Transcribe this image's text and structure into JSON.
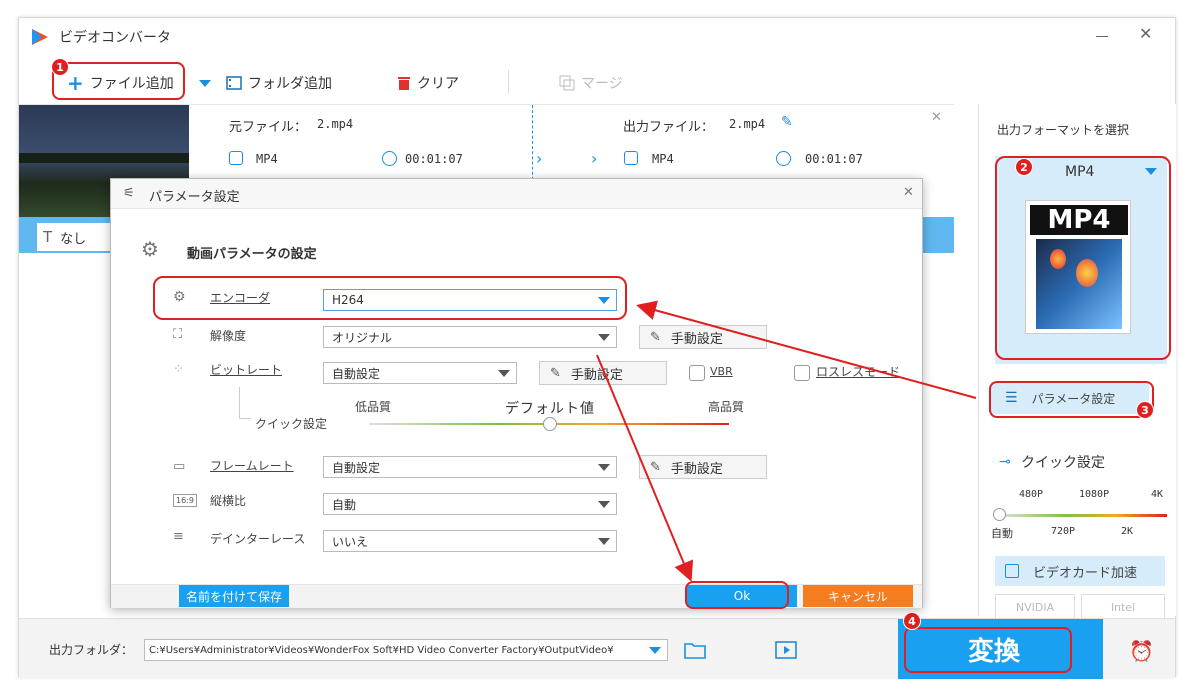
{
  "app": {
    "title": "ビデオコンバータ"
  },
  "toolbar": {
    "add_file": "ファイル追加",
    "add_folder": "フォルダ追加",
    "clear": "クリア",
    "merge": "マージ"
  },
  "file_item": {
    "source_label": "元ファイル：",
    "source_name": "2.mp4",
    "source_format": "MP4",
    "source_duration": "00:01:07",
    "output_label": "出力ファイル：",
    "output_name": "2.mp4",
    "output_format": "MP4",
    "output_duration": "00:01:07",
    "subtitle": "なし"
  },
  "dialog": {
    "title": "パラメータ設定",
    "section_title": "動画パラメータの設定",
    "encoder_label": "エンコーダ",
    "encoder_value": "H264",
    "resolution_label": "解像度",
    "resolution_value": "オリジナル",
    "manual_label": "手動設定",
    "bitrate_label": "ビットレート",
    "bitrate_value": "自動設定",
    "vbr_label": "VBR",
    "lossless_label": "ロスレスモード",
    "quick_label": "クイック設定",
    "quality_low": "低品質",
    "quality_default": "デフォルト値",
    "quality_high": "高品質",
    "framerate_label": "フレームレート",
    "framerate_value": "自動設定",
    "aspect_label": "縦横比",
    "aspect_icon_text": "16:9",
    "aspect_value": "自動",
    "deinterlace_label": "デインターレース",
    "deinterlace_value": "いいえ",
    "save_as": "名前を付けて保存",
    "ok": "Ok",
    "cancel": "キャンセル"
  },
  "right_panel": {
    "format_heading": "出力フォーマットを選択",
    "format_value": "MP4",
    "format_icon_text": "MP4",
    "param_button": "パラメータ設定",
    "quick_heading": "クイック設定",
    "res_top": [
      "480P",
      "1080P",
      "4K"
    ],
    "res_bottom": [
      "自動",
      "720P",
      "2K"
    ],
    "gpu_accel": "ビデオカード加速",
    "gpu_nvidia": "NVIDIA",
    "gpu_intel": "Intel"
  },
  "bottom": {
    "output_folder_label": "出力フォルダ：",
    "output_path": "C:¥Users¥Administrator¥Videos¥WonderFox Soft¥HD Video Converter Factory¥OutputVideo¥",
    "convert": "変換"
  },
  "badges": [
    "1",
    "2",
    "3",
    "4"
  ],
  "colors": {
    "accent": "#1aa0f0",
    "highlight": "#e02020",
    "cancel": "#f57c1f",
    "panel": "#d6ecfa"
  }
}
